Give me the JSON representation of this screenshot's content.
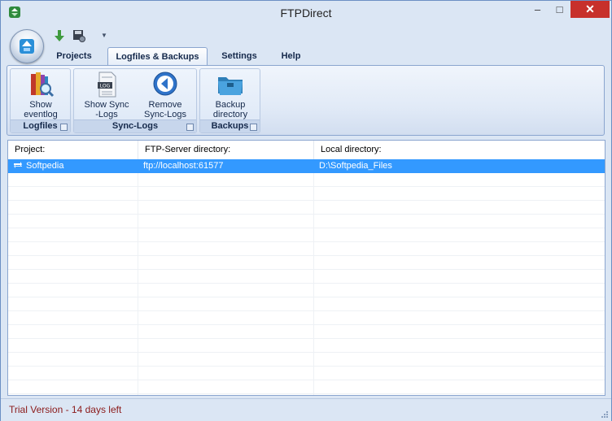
{
  "window": {
    "title": "FTPDirect",
    "controls": {
      "minimize": "–",
      "maximize": "□",
      "close": "✕"
    }
  },
  "ribbon": {
    "tabs": [
      {
        "label": "Projects",
        "active": false
      },
      {
        "label": "Logfiles & Backups",
        "active": true
      },
      {
        "label": "Settings",
        "active": false
      },
      {
        "label": "Help",
        "active": false
      }
    ],
    "groups": [
      {
        "label": "Logfiles",
        "buttons": [
          {
            "label_line1": "Show",
            "label_line2": "eventlog",
            "icon": "books-magnifier-icon"
          }
        ]
      },
      {
        "label": "Sync-Logs",
        "buttons": [
          {
            "label_line1": "Show Sync",
            "label_line2": "-Logs",
            "icon": "log-file-icon"
          },
          {
            "label_line1": "Remove",
            "label_line2": "Sync-Logs",
            "icon": "back-arrow-circle-icon"
          }
        ]
      },
      {
        "label": "Backups",
        "buttons": [
          {
            "label_line1": "Backup",
            "label_line2": "directory",
            "icon": "folder-icon"
          }
        ]
      }
    ]
  },
  "list": {
    "columns": [
      "Project:",
      "FTP-Server directory:",
      "Local directory:"
    ],
    "rows": [
      {
        "project": "Softpedia",
        "ftp": "ftp://localhost:61577",
        "local": "D:\\Softpedia_Files",
        "selected": true
      }
    ]
  },
  "status": {
    "text": "Trial Version - 14 days left"
  },
  "colors": {
    "selection": "#3399ff",
    "status_text": "#8b1a1a",
    "close_button": "#c7302b"
  }
}
